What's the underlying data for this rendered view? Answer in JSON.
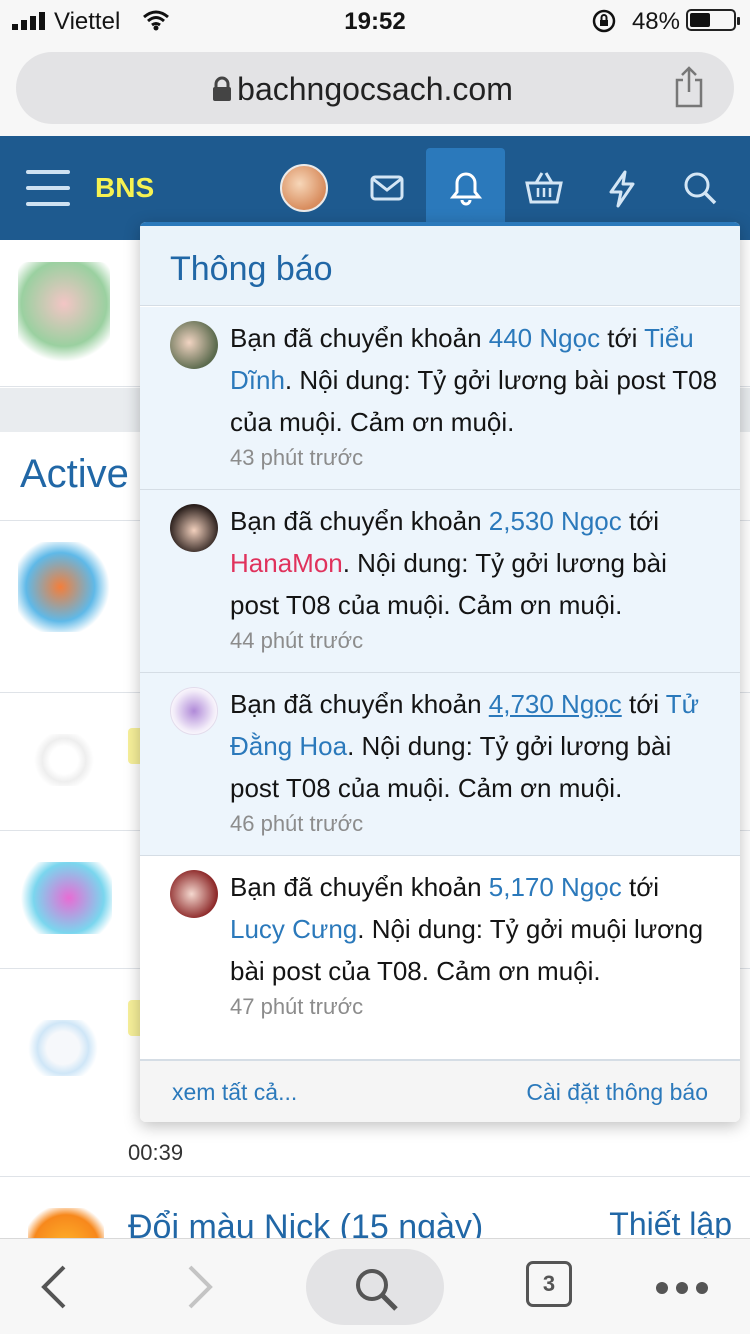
{
  "status_bar": {
    "carrier": "Viettel",
    "time": "19:52",
    "battery_percent": "48%",
    "battery_level": 0.48
  },
  "browser": {
    "url": "bachngocsach.com",
    "tab_count": "3"
  },
  "site_nav": {
    "brand": "BNS",
    "icons": [
      "menu-icon",
      "avatar",
      "mail-icon",
      "bell-icon",
      "basket-icon",
      "lightning-icon",
      "search-icon"
    ],
    "bell_color": "#2b79bb",
    "nav_color": "#1e5a8f"
  },
  "background_page": {
    "section_title": "Active",
    "time_label": "00:39",
    "bottom_item": "Đổi màu Nick (15 ngày)",
    "bottom_action": "Thiết lập"
  },
  "notifications": {
    "title": "Thông báo",
    "items": [
      {
        "prefix": "Bạn đã chuyển khoản ",
        "amount": "440 Ngọc",
        "mid": " tới",
        "user": "Tiểu Dĩnh",
        "content": ". Nội dung: Tỷ gởi lương bài post T08 của muội. Cảm ơn muội.",
        "time": "43 phút trước"
      },
      {
        "prefix": "Bạn đã chuyển khoản ",
        "amount": "2,530 Ngọc",
        "mid": " tới",
        "user": "HanaMon",
        "content": ". Nội dung: Tỷ gởi lương bài post T08 của muội. Cảm ơn muội.",
        "time": "44 phút trước"
      },
      {
        "prefix": "Bạn đã chuyển khoản ",
        "amount": "4,730 Ngọc",
        "mid": " tới",
        "user": "Tử Đằng Hoa",
        "content": ". Nội dung: Tỷ gởi lương bài post T08 của muội. Cảm ơn muội.",
        "time": "46 phút trước"
      },
      {
        "prefix": "Bạn đã chuyển khoản ",
        "amount": "5,170 Ngọc",
        "mid": " tới",
        "user": "Lucy Cưng",
        "content": ". Nội dung: Tỷ gởi muội lương bài post của T08. Cảm ơn muội.",
        "time": "47 phút trước"
      }
    ],
    "footer_view_all": "xem tất cả...",
    "footer_settings": "Cài đặt thông báo"
  }
}
